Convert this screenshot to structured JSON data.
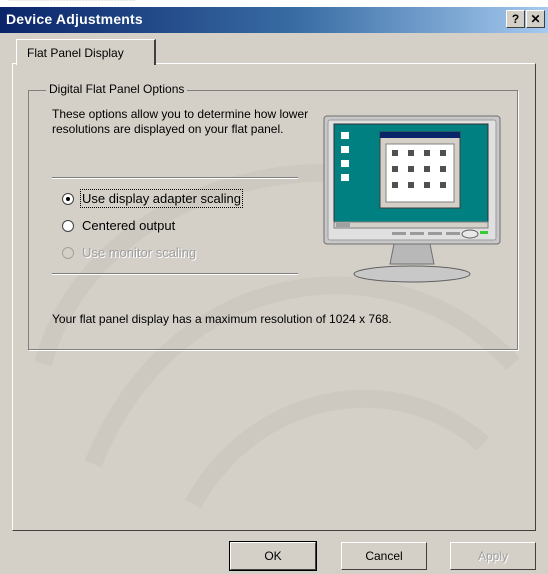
{
  "window": {
    "title": "Device Adjustments",
    "help_label": "?",
    "close_label": "✕"
  },
  "tabs": [
    {
      "label": "Flat Panel Display",
      "active": true
    }
  ],
  "group": {
    "title": "Digital Flat Panel Options",
    "description": "These options allow you to determine how lower resolutions are displayed on your flat panel.",
    "options": [
      {
        "label": "Use display adapter scaling",
        "checked": true,
        "enabled": true
      },
      {
        "label": "Centered output",
        "checked": false,
        "enabled": true
      },
      {
        "label": "Use monitor scaling",
        "checked": false,
        "enabled": false
      }
    ],
    "max_resolution_text": "Your flat panel display has a maximum resolution of 1024 x 768."
  },
  "buttons": {
    "ok": "OK",
    "cancel": "Cancel",
    "apply": "Apply"
  },
  "colors": {
    "title_bar": "#0a246a",
    "dialog_face": "#d4d0c8",
    "desktop_teal": "#008080"
  }
}
